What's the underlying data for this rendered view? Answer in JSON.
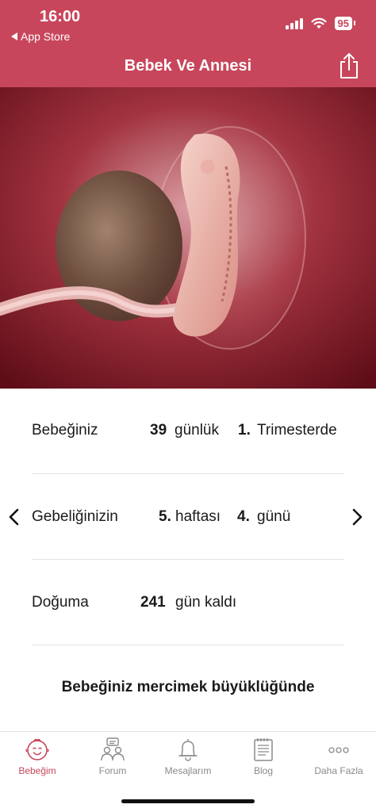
{
  "status": {
    "time": "16:00",
    "back_app": "App Store",
    "battery": "95"
  },
  "header": {
    "title": "Bebek Ve Annesi",
    "share_icon": "share-icon"
  },
  "stats": {
    "row1": {
      "label": "Bebeğiniz",
      "days_value": "39",
      "days_unit": "günlük",
      "trimester_value": "1.",
      "trimester_unit": "Trimesterde"
    },
    "row2": {
      "label": "Gebeliğinizin",
      "week_value": "5.",
      "week_unit": "haftası",
      "day_value": "4.",
      "day_unit": "günü"
    },
    "row3": {
      "label": "Doğuma",
      "remaining_value": "241",
      "remaining_unit": "gün kaldı"
    }
  },
  "size_caption": "Bebeğiniz mercimek büyüklüğünde",
  "tabbar": {
    "tabs": [
      {
        "label": "Bebeğim",
        "icon": "baby-face-icon",
        "active": true
      },
      {
        "label": "Forum",
        "icon": "forum-people-icon",
        "active": false
      },
      {
        "label": "Mesajlarım",
        "icon": "bell-icon",
        "active": false
      },
      {
        "label": "Blog",
        "icon": "notepad-icon",
        "active": false
      },
      {
        "label": "Daha Fazla",
        "icon": "more-dots-icon",
        "active": false
      }
    ]
  },
  "colors": {
    "accent": "#c8465c",
    "inactive": "#8a8a8a"
  }
}
